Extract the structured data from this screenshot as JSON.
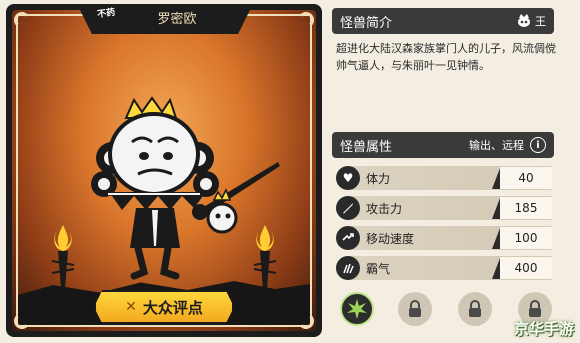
{
  "card": {
    "badge": "不药",
    "name": "罗密欧",
    "review_label": "大众评点"
  },
  "intro": {
    "title": "怪兽简介",
    "rank": "王",
    "text": "超进化大陆汉森家族掌门人的儿子，风流倜傥帅气逼人，与朱丽叶一见钟情。"
  },
  "attributes": {
    "title": "怪兽属性",
    "type": "输出、远程",
    "info_label": "i",
    "stats": [
      {
        "icon": "heart-icon",
        "label": "体力",
        "value": "40"
      },
      {
        "icon": "sword-icon",
        "label": "攻击力",
        "value": "185"
      },
      {
        "icon": "speed-icon",
        "label": "移动速度",
        "value": "100"
      },
      {
        "icon": "claw-icon",
        "label": "霸气",
        "value": "400"
      }
    ]
  },
  "skills": [
    {
      "icon": "skill-burst-icon",
      "state": "unlocked"
    },
    {
      "icon": "lock-icon",
      "state": "locked"
    },
    {
      "icon": "lock-icon",
      "state": "locked"
    },
    {
      "icon": "lock-icon",
      "state": "locked"
    }
  ],
  "watermark": "京华手游",
  "colors": {
    "header_bg": "#3a3a3a",
    "card_dark": "#1c1c1c",
    "accent_yellow": "#ffd83d",
    "skill_glow": "#bfe38a"
  }
}
